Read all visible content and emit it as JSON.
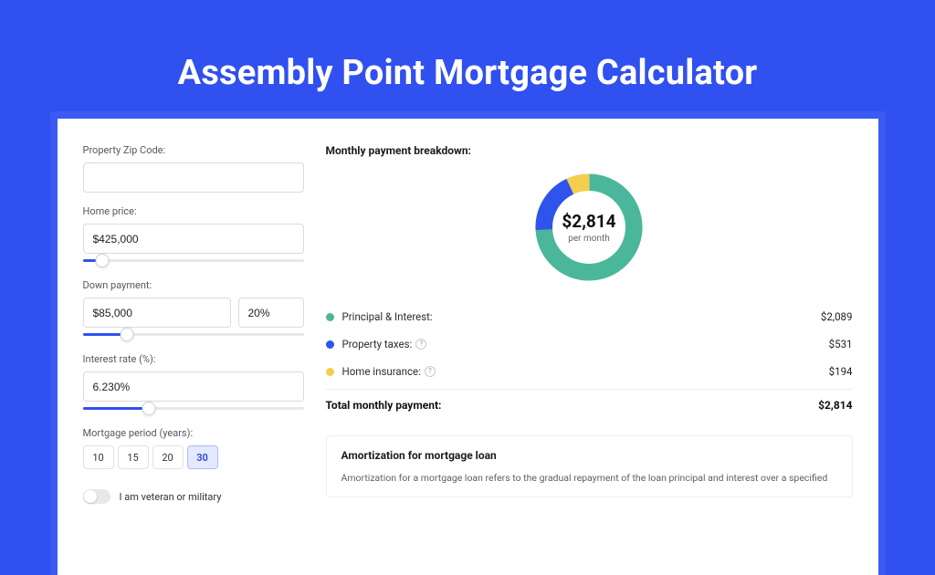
{
  "header": {
    "title": "Assembly Point Mortgage Calculator"
  },
  "form": {
    "zip_label": "Property Zip Code:",
    "zip_value": "",
    "price_label": "Home price:",
    "price_value": "$425,000",
    "price_slider_pct": 9,
    "down_label": "Down payment:",
    "down_value": "$85,000",
    "down_pct_value": "20%",
    "down_slider_pct": 20,
    "rate_label": "Interest rate (%):",
    "rate_value": "6.230%",
    "rate_slider_pct": 30,
    "period_label": "Mortgage period (years):",
    "period_options": [
      "10",
      "15",
      "20",
      "30"
    ],
    "period_selected": "30",
    "veteran_label": "I am veteran or military"
  },
  "breakdown": {
    "title": "Monthly payment breakdown:",
    "amount": "$2,814",
    "sub": "per month",
    "items": [
      {
        "label": "Principal & Interest:",
        "value": "$2,089",
        "color": "#4bb79a",
        "info": false,
        "pct": 74
      },
      {
        "label": "Property taxes:",
        "value": "$531",
        "color": "#2f54eb",
        "info": true,
        "pct": 19
      },
      {
        "label": "Home insurance:",
        "value": "$194",
        "color": "#f4cd4c",
        "info": true,
        "pct": 7
      }
    ],
    "total_label": "Total monthly payment:",
    "total_value": "$2,814"
  },
  "amort": {
    "title": "Amortization for mortgage loan",
    "text": "Amortization for a mortgage loan refers to the gradual repayment of the loan principal and interest over a specified"
  },
  "chart_data": {
    "type": "pie",
    "title": "Monthly payment breakdown",
    "categories": [
      "Principal & Interest",
      "Property taxes",
      "Home insurance"
    ],
    "values": [
      2089,
      531,
      194
    ],
    "colors": [
      "#4bb79a",
      "#2f54eb",
      "#f4cd4c"
    ],
    "total": 2814,
    "unit": "USD per month"
  }
}
